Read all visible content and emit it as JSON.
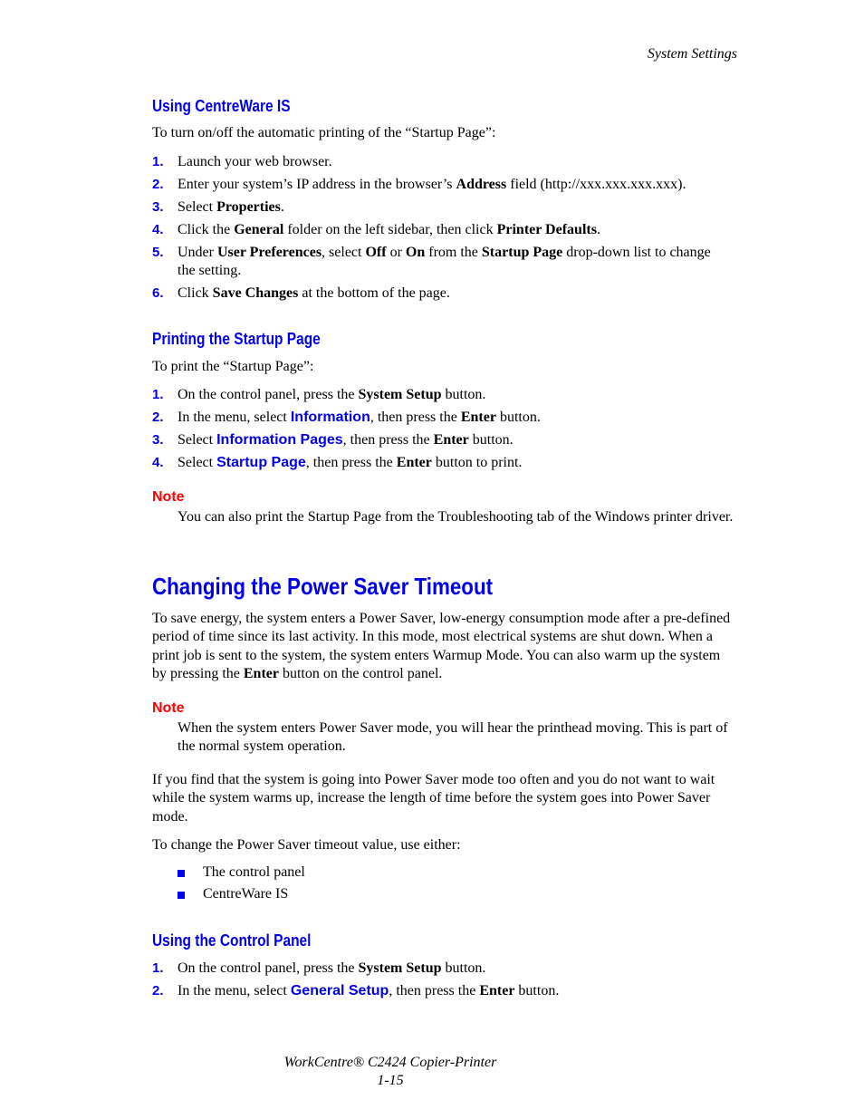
{
  "running_head": "System Settings",
  "section1": {
    "heading": "Using CentreWare IS",
    "intro": "To turn on/off the automatic printing of the “Startup Page”:",
    "steps": [
      {
        "num": "1.",
        "parts": [
          "Launch your web browser."
        ]
      },
      {
        "num": "2.",
        "parts": [
          "Enter your system’s IP address in the browser’s ",
          "Address",
          " field (http://xxx.xxx.xxx.xxx)."
        ]
      },
      {
        "num": "3.",
        "parts": [
          "Select ",
          "Properties",
          "."
        ]
      },
      {
        "num": "4.",
        "parts": [
          "Click the ",
          "General",
          " folder on the left sidebar, then click ",
          "Printer Defaults",
          "."
        ]
      },
      {
        "num": "5.",
        "parts": [
          "Under ",
          "User Preferences",
          ", select ",
          "Off",
          " or ",
          "On",
          " from the ",
          "Startup Page",
          " drop-down list to change the setting."
        ]
      },
      {
        "num": "6.",
        "parts": [
          "Click ",
          "Save Changes",
          " at the bottom of the page."
        ]
      }
    ]
  },
  "section2": {
    "heading": "Printing the Startup Page",
    "intro": "To print the “Startup Page”:",
    "steps": [
      {
        "num": "1.",
        "parts": [
          "On the control panel, press the ",
          "System Setup",
          " button."
        ]
      },
      {
        "num": "2.",
        "parts": [
          "In the menu, select ",
          "Information",
          ", then press the ",
          "Enter",
          " button."
        ]
      },
      {
        "num": "3.",
        "parts": [
          "Select ",
          "Information Pages",
          ", then press the ",
          "Enter",
          " button."
        ]
      },
      {
        "num": "4.",
        "parts": [
          "Select ",
          "Startup Page",
          ", then press the ",
          "Enter",
          " button to print."
        ]
      }
    ],
    "note_label": "Note",
    "note_text": "You can also print the Startup Page from the Troubleshooting tab of the Windows printer driver."
  },
  "section3": {
    "heading": "Changing the Power Saver Timeout",
    "para1_parts": [
      "To save energy, the system enters a Power Saver, low-energy consumption mode after a pre-defined period of time since its last activity. In this mode, most electrical systems are shut down. When a print job is sent to the system, the system enters Warmup Mode. You can also warm up the system by pressing the ",
      "Enter",
      " button on the control panel."
    ],
    "note_label": "Note",
    "note_text": "When the system enters Power Saver mode, you will hear the printhead moving. This is part of the normal system operation.",
    "para2": "If you find that the system is going into Power Saver mode too often and you do not want to wait while the system warms up, increase the length of time before the system goes into Power Saver mode.",
    "para3": "To change the Power Saver timeout value, use either:",
    "bullets": [
      "The control panel",
      "CentreWare IS"
    ]
  },
  "section4": {
    "heading": "Using the Control Panel",
    "steps": [
      {
        "num": "1.",
        "parts": [
          "On the control panel, press the ",
          "System Setup",
          " button."
        ]
      },
      {
        "num": "2.",
        "parts": [
          "In the menu, select ",
          "General Setup",
          ", then press the ",
          "Enter",
          " button."
        ]
      }
    ]
  },
  "footer": {
    "product": "WorkCentre® C2424 Copier-Printer",
    "page_number": "1-15"
  },
  "colors": {
    "heading_blue": "#0000ee",
    "note_red": "#ff0000"
  }
}
